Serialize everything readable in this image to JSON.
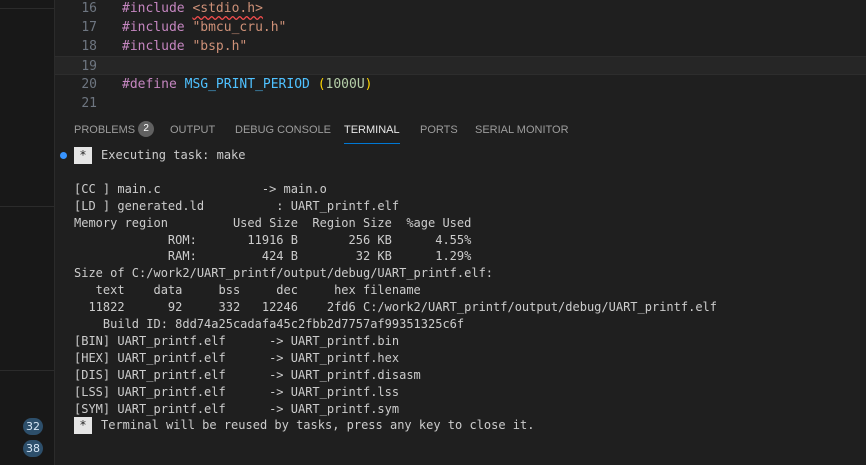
{
  "editor": {
    "lines": [
      {
        "number": "16",
        "tokens": [
          {
            "t": "#include ",
            "c": "kw"
          },
          {
            "t": "<stdio.h>",
            "c": "str squig"
          }
        ]
      },
      {
        "number": "17",
        "tokens": [
          {
            "t": "#include ",
            "c": "kw"
          },
          {
            "t": "\"bmcu_cru.h\"",
            "c": "str"
          }
        ]
      },
      {
        "number": "18",
        "tokens": [
          {
            "t": "#include ",
            "c": "kw"
          },
          {
            "t": "\"bsp.h\"",
            "c": "str"
          }
        ]
      },
      {
        "number": "19",
        "tokens": []
      },
      {
        "number": "20",
        "tokens": [
          {
            "t": "#define ",
            "c": "kw"
          },
          {
            "t": "MSG_PRINT_PERIOD",
            "c": "ident"
          },
          {
            "t": " ",
            "c": ""
          },
          {
            "t": "(",
            "c": "paren"
          },
          {
            "t": "1000U",
            "c": "num"
          },
          {
            "t": ")",
            "c": "paren"
          }
        ]
      },
      {
        "number": "21",
        "tokens": []
      }
    ],
    "current_line": "19"
  },
  "panel": {
    "tabs": [
      {
        "label": "PROBLEMS",
        "badge": "2",
        "active": false
      },
      {
        "label": "OUTPUT",
        "active": false
      },
      {
        "label": "DEBUG CONSOLE",
        "active": false
      },
      {
        "label": "TERMINAL",
        "active": true
      },
      {
        "label": "PORTS",
        "active": false
      },
      {
        "label": "SERIAL MONITOR",
        "active": false
      }
    ]
  },
  "sidebar": {
    "badges": [
      "32",
      "38"
    ]
  },
  "terminal": {
    "task_marker": "*",
    "lines": [
      "Executing task: make",
      "",
      "[CC ] main.c              -> main.o",
      "[LD ] generated.ld          : UART_printf.elf",
      "Memory region         Used Size  Region Size  %age Used",
      "             ROM:       11916 B       256 KB      4.55%",
      "             RAM:         424 B        32 KB      1.29%",
      "Size of C:/work2/UART_printf/output/debug/UART_printf.elf:",
      "   text    data     bss     dec     hex filename",
      "  11822      92     332   12246    2fd6 C:/work2/UART_printf/output/debug/UART_printf.elf",
      "    Build ID: 8dd74a25cadafa45c2fbb2d7757af99351325c6f",
      "[BIN] UART_printf.elf      -> UART_printf.bin",
      "[HEX] UART_printf.elf      -> UART_printf.hex",
      "[DIS] UART_printf.elf      -> UART_printf.disasm",
      "[LSS] UART_printf.elf      -> UART_printf.lss",
      "[SYM] UART_printf.elf      -> UART_printf.sym",
      "Terminal will be reused by tasks, press any key to close it."
    ]
  }
}
